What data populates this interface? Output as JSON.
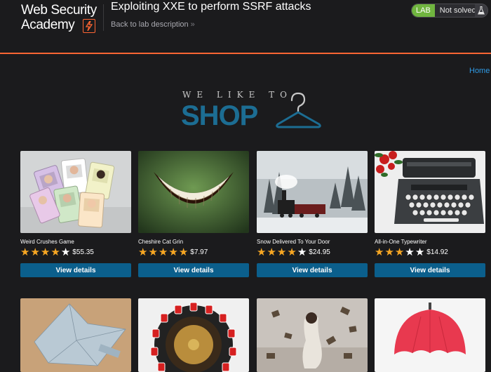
{
  "header": {
    "logo_line1": "Web Security",
    "logo_line2": "Academy",
    "lab_title": "Exploiting XXE to perform SSRF attacks",
    "back_link": "Back to lab description",
    "back_chevron": "»",
    "status_badge": "LAB",
    "status_text": "Not solved",
    "accent_color": "#ff6633"
  },
  "nav": {
    "home": "Home"
  },
  "banner": {
    "tagline": "WE LIKE TO",
    "word": "SHOP"
  },
  "products_row1": [
    {
      "name": "Weird Crushes Game",
      "stars": 4,
      "price": "$55.35",
      "button": "View details"
    },
    {
      "name": "Cheshire Cat Grin",
      "stars": 5,
      "price": "$7.97",
      "button": "View details"
    },
    {
      "name": "Snow Delivered To Your Door",
      "stars": 4,
      "price": "$24.95",
      "button": "View details"
    },
    {
      "name": "All-in-One Typewriter",
      "stars": 3,
      "price": "$14.92",
      "button": "View details"
    }
  ],
  "colors": {
    "star_on": "#f6a623",
    "button": "#0b5f8c",
    "link": "#2f9be6",
    "lab_green": "#70b53f"
  }
}
